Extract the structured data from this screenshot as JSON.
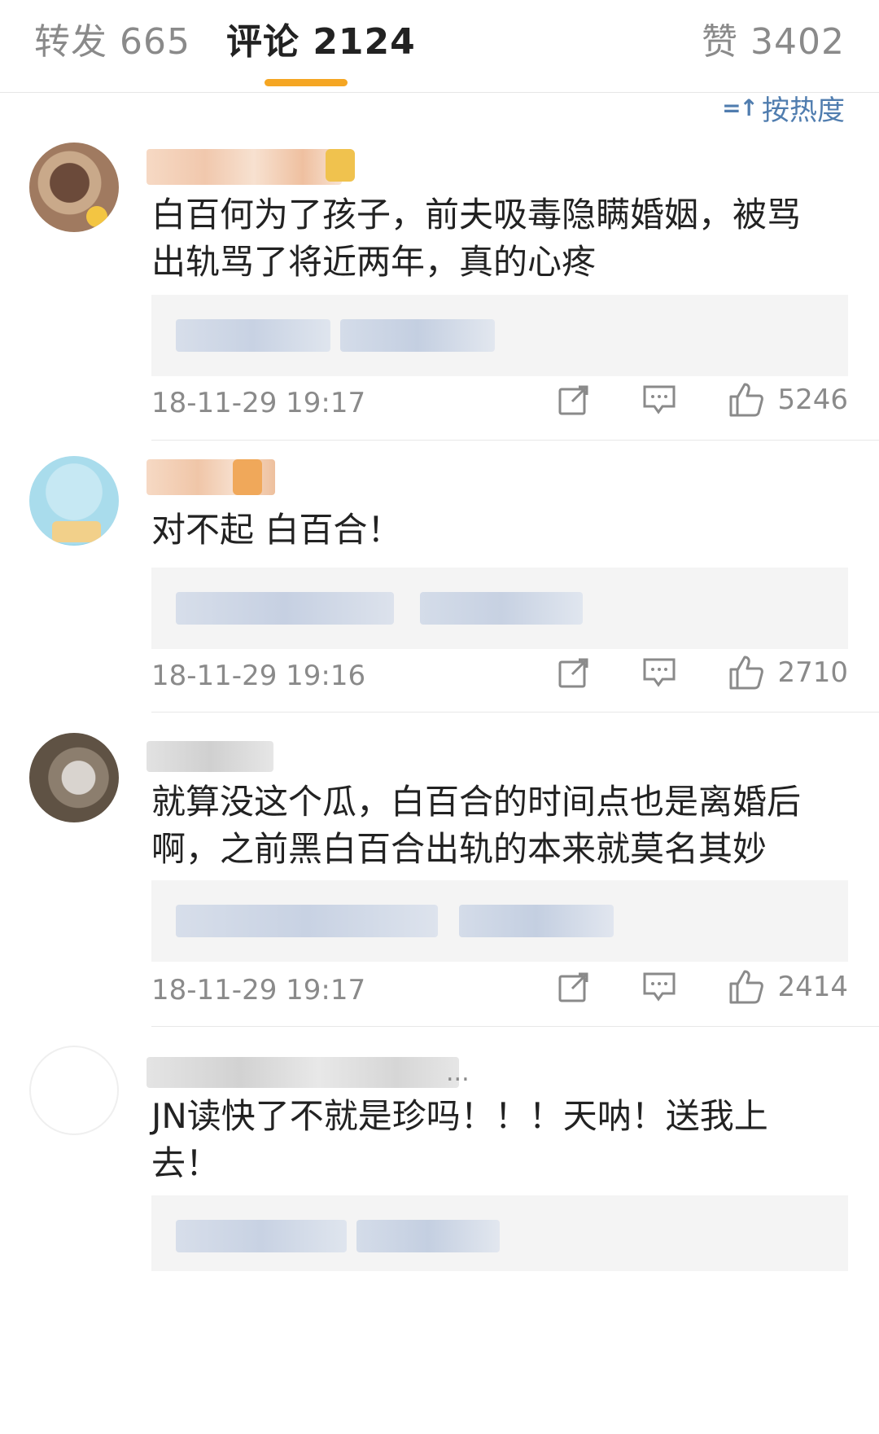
{
  "tabs": {
    "repost": "转发 665",
    "comments": "评论 2124",
    "likes": "赞 3402"
  },
  "sort": {
    "label": "按热度",
    "icon": "sort-icon"
  },
  "accent_color": "#f5a623",
  "link_color": "#507daf",
  "comments": [
    {
      "text": "白百何为了孩子，前夫吸毒隐瞒婚姻，被骂\n出轨骂了将近两年，真的心疼",
      "time": "18-11-29 19:17",
      "likes": "5246"
    },
    {
      "text": "对不起 白百合！",
      "time": "18-11-29 19:16",
      "likes": "2710"
    },
    {
      "text": "就算没这个瓜，白百合的时间点也是离婚后\n啊，之前黑白百合出轨的本来就莫名其妙",
      "time": "18-11-29 19:17",
      "likes": "2414"
    },
    {
      "text": "JN读快了不就是珍吗！！！天呐！送我上\n去！",
      "time": "",
      "likes": "",
      "username_suffix": "..."
    }
  ]
}
